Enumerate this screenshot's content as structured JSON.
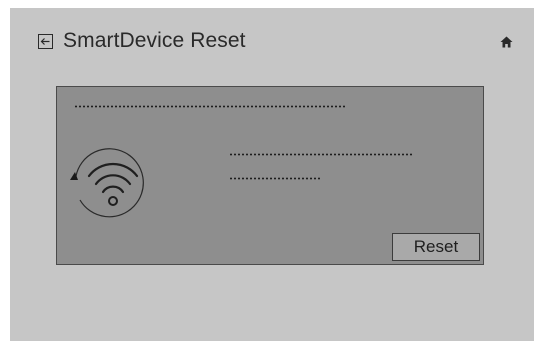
{
  "header": {
    "title": "SmartDevice Reset",
    "back_icon": "back-arrow-icon",
    "home_icon": "home-icon"
  },
  "panel": {
    "illustration_icon": "wifi-reset-icon",
    "reset_button_label": "Reset"
  },
  "colors": {
    "screen_background": "#c6c6c6",
    "panel_background": "#8e8e8e",
    "button_background": "#a9a9a9",
    "text": "#2a2a2a"
  }
}
